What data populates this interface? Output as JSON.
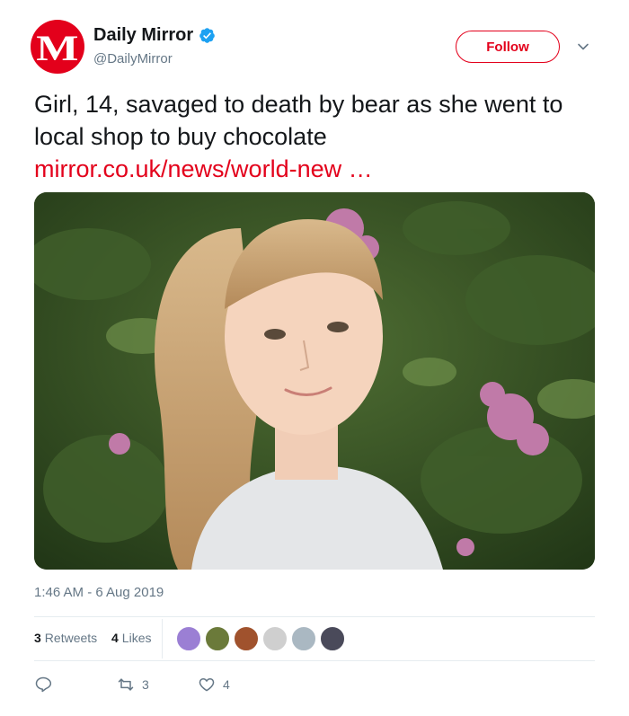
{
  "account": {
    "name": "Daily Mirror",
    "handle": "@DailyMirror",
    "avatar_letter": "M",
    "brand_color": "#e3001b"
  },
  "follow_button": {
    "label": "Follow"
  },
  "tweet": {
    "text": "Girl, 14, savaged to death by bear as she went to local shop to buy chocolate",
    "link": "mirror.co.uk/news/world-new …",
    "timestamp": "1:46 AM - 6 Aug 2019"
  },
  "stats": {
    "retweets_count": "3",
    "retweets_label": "Retweets",
    "likes_count": "4",
    "likes_label": "Likes"
  },
  "actions": {
    "retweet_count": "3",
    "like_count": "4"
  },
  "icons": {
    "verified": "verified-badge-icon",
    "menu": "chevron-down-icon",
    "reply": "reply-icon",
    "retweet": "retweet-icon",
    "like": "heart-icon"
  },
  "liker_avatar_colors": [
    "#9b7fd4",
    "#6b7a3a",
    "#a0522d",
    "#cfcfcf",
    "#aab8c2",
    "#4a4a5a"
  ]
}
